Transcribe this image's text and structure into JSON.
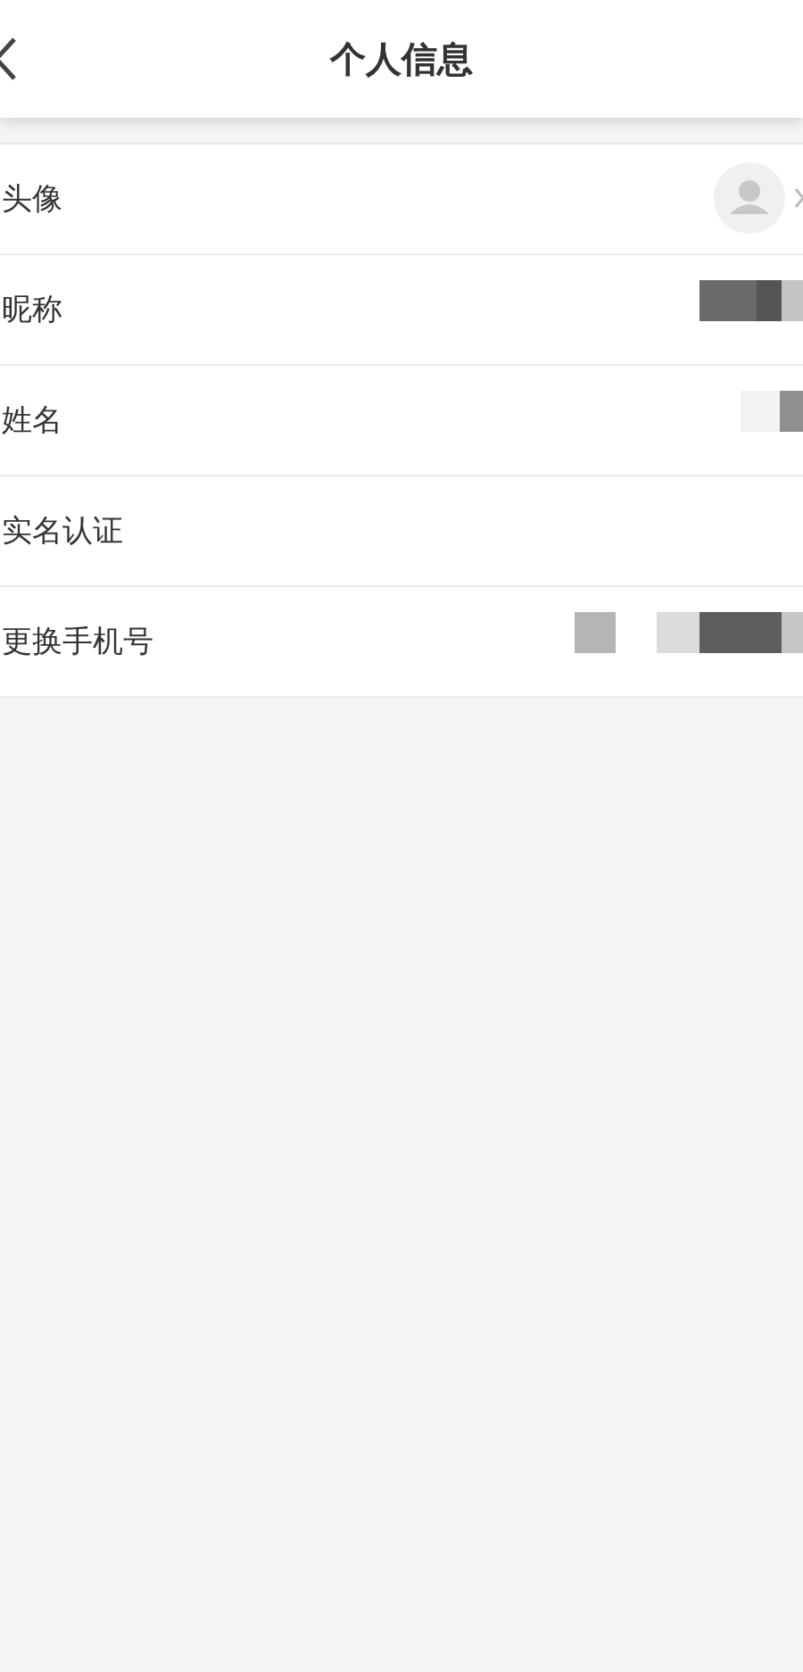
{
  "header": {
    "title": "个人信息"
  },
  "rows": [
    {
      "label": "头像",
      "kind": "avatar"
    },
    {
      "label": "昵称",
      "kind": "mosaic"
    },
    {
      "label": "姓名",
      "kind": "mosaic"
    },
    {
      "label": "实名认证",
      "kind": "plain"
    },
    {
      "label": "更换手机号",
      "kind": "mosaic"
    }
  ]
}
